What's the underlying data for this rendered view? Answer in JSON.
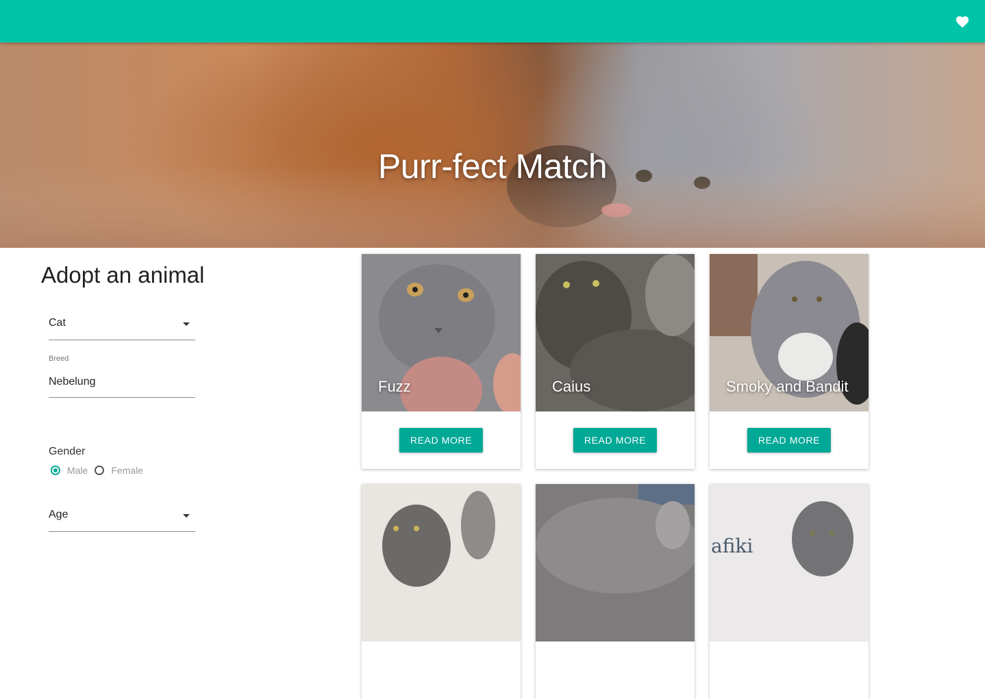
{
  "header": {
    "favorites_icon": "heart-icon",
    "brand_color": "#00c4a7"
  },
  "hero": {
    "title": "Purr-fect Match"
  },
  "sidebar": {
    "title": "Adopt an animal",
    "type_select": {
      "value": "Cat"
    },
    "breed_field": {
      "label": "Breed",
      "value": "Nebelung"
    },
    "gender": {
      "label": "Gender",
      "options": [
        "Male",
        "Female"
      ],
      "selected": "Male"
    },
    "age_select": {
      "value": "Age"
    }
  },
  "cards": [
    {
      "name": "Fuzz",
      "button": "READ MORE"
    },
    {
      "name": "Caius",
      "button": "READ MORE"
    },
    {
      "name": "Smoky and Bandit",
      "button": "READ MORE"
    },
    {
      "name": "",
      "button": ""
    },
    {
      "name": "",
      "button": ""
    },
    {
      "name": "",
      "button": ""
    }
  ],
  "partial_text": {
    "card6_watermark": "afiki"
  },
  "accent_color": "#00a896"
}
